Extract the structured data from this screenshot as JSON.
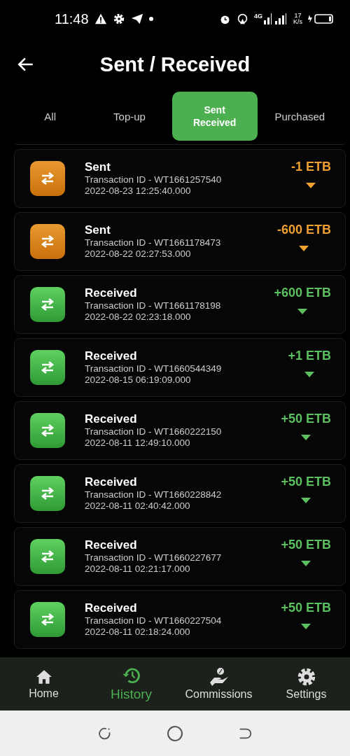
{
  "status_bar": {
    "time": "11:48",
    "network": "4G",
    "speed": "17",
    "speed_unit": "K/s"
  },
  "header": {
    "title": "Sent / Received"
  },
  "tabs": [
    {
      "label": "All",
      "selected": false
    },
    {
      "label": "Top-up",
      "selected": false
    },
    {
      "label": "Sent\nReceived",
      "selected": true
    },
    {
      "label": "Purchased",
      "selected": false
    }
  ],
  "transactions": [
    {
      "kind": "sent",
      "title": "Sent",
      "transaction_id": "Transaction ID - WT1661257540",
      "date": "2022-08-23 12:25:40.000",
      "amount": "-1 ETB"
    },
    {
      "kind": "sent",
      "title": "Sent",
      "transaction_id": "Transaction ID - WT1661178473",
      "date": "2022-08-22 02:27:53.000",
      "amount": "-600 ETB"
    },
    {
      "kind": "received",
      "title": "Received",
      "transaction_id": "Transaction ID - WT1661178198",
      "date": "2022-08-22 02:23:18.000",
      "amount": "+600 ETB"
    },
    {
      "kind": "received",
      "title": "Received",
      "transaction_id": "Transaction ID - WT1660544349",
      "date": "2022-08-15 06:19:09.000",
      "amount": "+1 ETB"
    },
    {
      "kind": "received",
      "title": "Received",
      "transaction_id": "Transaction ID - WT1660222150",
      "date": "2022-08-11 12:49:10.000",
      "amount": "+50 ETB"
    },
    {
      "kind": "received",
      "title": "Received",
      "transaction_id": "Transaction ID - WT1660228842",
      "date": "2022-08-11 02:40:42.000",
      "amount": "+50 ETB"
    },
    {
      "kind": "received",
      "title": "Received",
      "transaction_id": "Transaction ID - WT1660227677",
      "date": "2022-08-11 02:21:17.000",
      "amount": "+50 ETB"
    },
    {
      "kind": "received",
      "title": "Received",
      "transaction_id": "Transaction ID - WT1660227504",
      "date": "2022-08-11 02:18:24.000",
      "amount": "+50 ETB"
    }
  ],
  "bottom_nav": [
    {
      "kind": "home",
      "label": "Home",
      "selected": false
    },
    {
      "kind": "history",
      "label": "History",
      "selected": true
    },
    {
      "kind": "commissions",
      "label": "Commissions",
      "selected": false
    },
    {
      "kind": "settings",
      "label": "Settings",
      "selected": false
    }
  ]
}
